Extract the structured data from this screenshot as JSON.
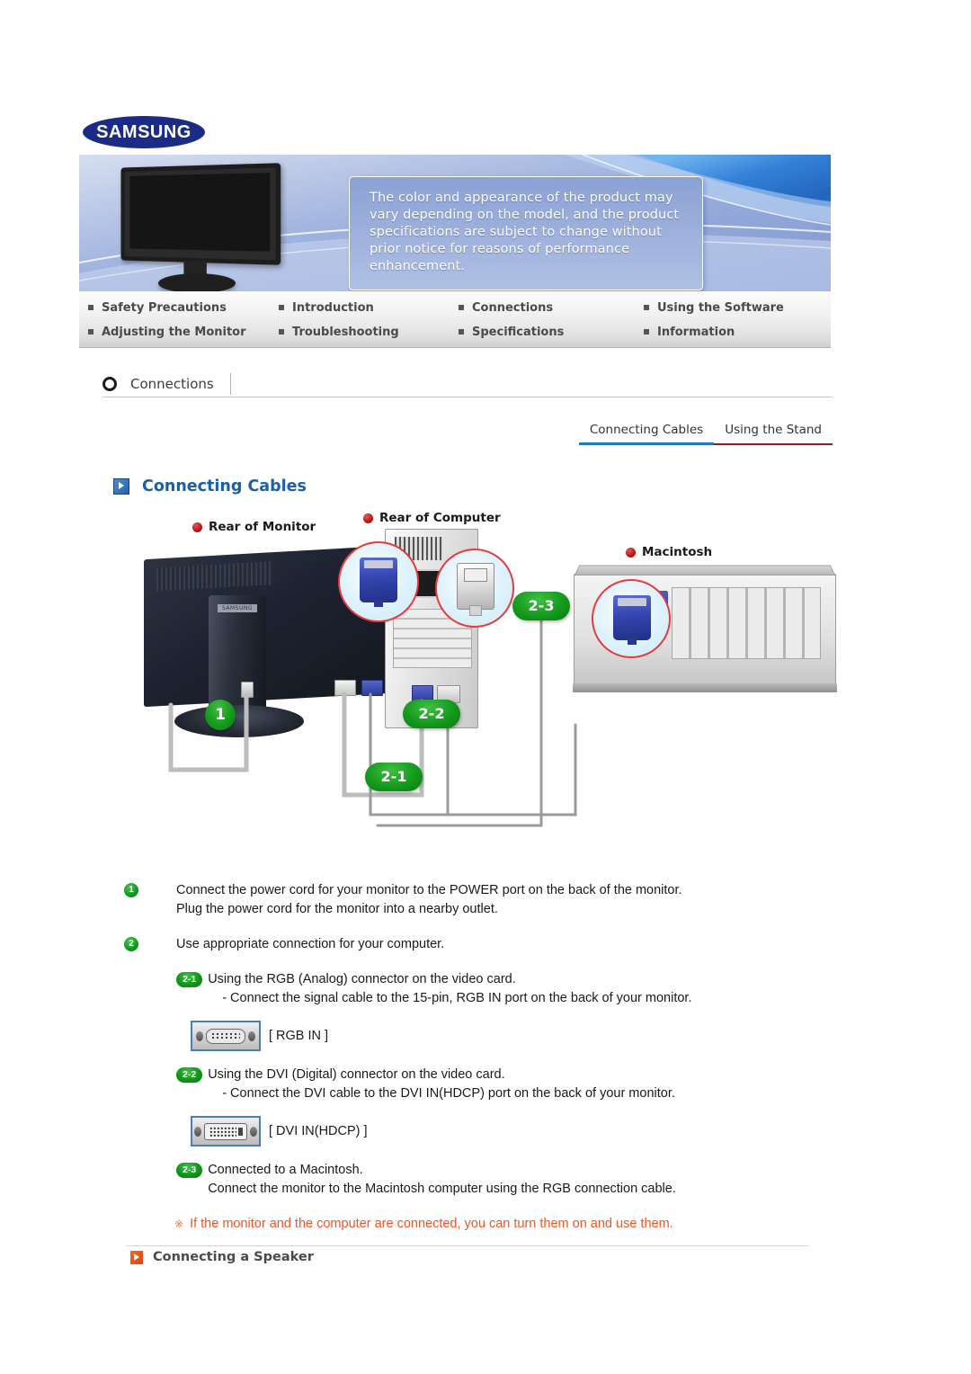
{
  "brand": {
    "logo_text": "SAMSUNG"
  },
  "hero": {
    "notice": "The color and appearance of the product may vary depending on the model, and the product specifications are subject to change without prior notice for reasons of performance enhancement."
  },
  "nav": {
    "items": [
      {
        "label": "Safety Precautions"
      },
      {
        "label": "Introduction"
      },
      {
        "label": "Connections"
      },
      {
        "label": "Using the Software"
      },
      {
        "label": "Adjusting the Monitor"
      },
      {
        "label": "Troubleshooting"
      },
      {
        "label": "Specifications"
      },
      {
        "label": "Information"
      }
    ]
  },
  "section": {
    "title": "Connections"
  },
  "tabs": [
    {
      "label": "Connecting Cables",
      "active": true,
      "underline": "#1d7dbd"
    },
    {
      "label": "Using the Stand",
      "active": false,
      "underline": "#8b2020"
    }
  ],
  "page_title": {
    "text": "Connecting Cables"
  },
  "diagram": {
    "labels": {
      "monitor": "Rear of Monitor",
      "computer": "Rear of Computer",
      "macintosh": "Macintosh"
    },
    "badges": {
      "one": "1",
      "two_one": "2-1",
      "two_two": "2-2",
      "two_three": "2-3"
    },
    "monitor_brand": "SAMSUNG"
  },
  "instructions": {
    "step1": {
      "number": "1",
      "line1": "Connect the power cord for your monitor to the POWER port on the back of the monitor.",
      "line2": "Plug the power cord for the monitor into a nearby outlet."
    },
    "step2": {
      "number": "2",
      "line1": "Use appropriate connection for your computer.",
      "sub": [
        {
          "badge": "2-1",
          "line1": "Using the RGB (Analog) connector on the video card.",
          "line2": "- Connect the signal cable to the 15-pin, RGB IN port on the back of your monitor."
        },
        {
          "badge": "2-2",
          "line1": "Using the DVI (Digital) connector on the video card.",
          "line2": "- Connect the DVI cable to the DVI IN(HDCP) port on the back of your monitor."
        },
        {
          "badge": "2-3",
          "line1": "Connected to a Macintosh.",
          "line2": "Connect the monitor to the Macintosh computer using the RGB connection cable."
        }
      ]
    },
    "port_rgb_caption": "[ RGB IN ]",
    "port_dvi_caption": "[ DVI IN(HDCP) ]",
    "note_mark": "※",
    "note_text": "If the monitor and the computer are connected, you can turn them on and use them."
  },
  "speaker_section": {
    "title": "Connecting a Speaker"
  },
  "colors": {
    "brand_blue": "#1b2b86",
    "title_blue": "#1a5fa8",
    "tab_active": "#1d7dbd",
    "tab_alt": "#8b2020",
    "badge_green": "#12951b",
    "note_orange": "#ee5522",
    "speaker_orange": "#d9431a"
  }
}
